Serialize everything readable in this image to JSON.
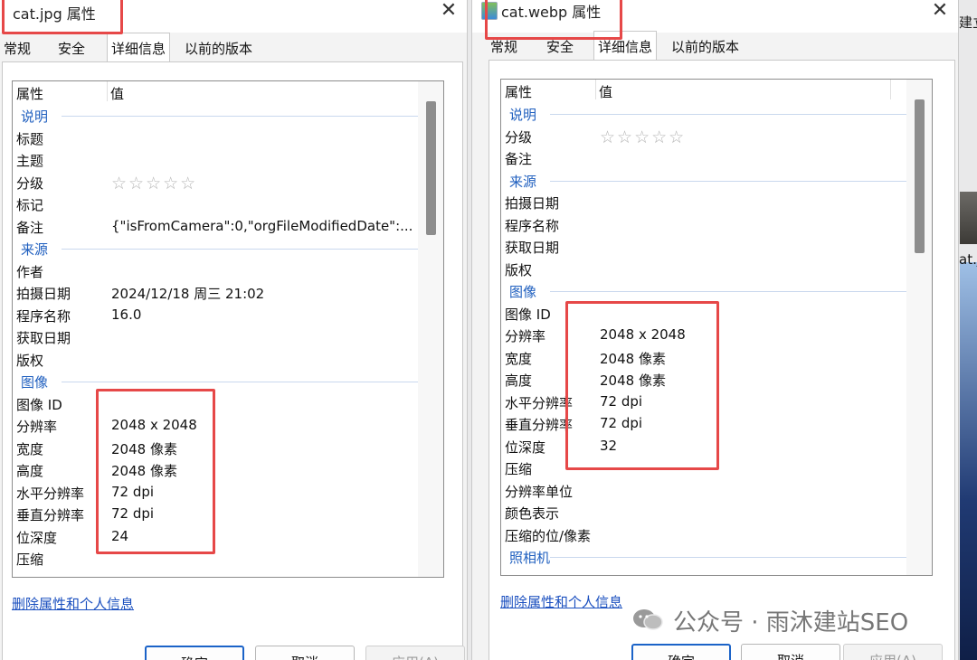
{
  "left": {
    "title": "cat.jpg 属性",
    "tabs": [
      "常规",
      "安全",
      "详细信息",
      "以前的版本"
    ],
    "header": {
      "property": "属性",
      "value": "值"
    },
    "rows": [
      {
        "k": "说明",
        "section": true
      },
      {
        "k": "标题",
        "v": ""
      },
      {
        "k": "主题",
        "v": ""
      },
      {
        "k": "分级",
        "v": "☆☆☆☆☆",
        "stars": true
      },
      {
        "k": "标记",
        "v": ""
      },
      {
        "k": "备注",
        "v": "{\"isFromCamera\":0,\"orgFileModifiedDate\":..."
      },
      {
        "k": "来源",
        "section": true
      },
      {
        "k": "作者",
        "v": ""
      },
      {
        "k": "拍摄日期",
        "v": "2024/12/18 周三 21:02"
      },
      {
        "k": "程序名称",
        "v": "16.0"
      },
      {
        "k": "获取日期",
        "v": ""
      },
      {
        "k": "版权",
        "v": ""
      },
      {
        "k": "图像",
        "section": true
      },
      {
        "k": "图像 ID",
        "v": ""
      },
      {
        "k": "分辨率",
        "v": "2048 x 2048"
      },
      {
        "k": "宽度",
        "v": "2048 像素"
      },
      {
        "k": "高度",
        "v": "2048 像素"
      },
      {
        "k": "水平分辨率",
        "v": "72 dpi"
      },
      {
        "k": "垂直分辨率",
        "v": "72 dpi"
      },
      {
        "k": "位深度",
        "v": "24"
      },
      {
        "k": "压缩",
        "v": ""
      }
    ],
    "remove_link": "删除属性和个人信息",
    "buttons": {
      "ok": "确定",
      "cancel": "取消",
      "apply": "应用(A)"
    }
  },
  "right": {
    "title": "cat.webp 属性",
    "tabs": [
      "常规",
      "安全",
      "详细信息",
      "以前的版本"
    ],
    "header": {
      "property": "属性",
      "value": "值"
    },
    "rows": [
      {
        "k": "说明",
        "section": true
      },
      {
        "k": "分级",
        "v": "☆☆☆☆☆",
        "stars": true
      },
      {
        "k": "备注",
        "v": ""
      },
      {
        "k": "来源",
        "section": true
      },
      {
        "k": "拍摄日期",
        "v": ""
      },
      {
        "k": "程序名称",
        "v": ""
      },
      {
        "k": "获取日期",
        "v": ""
      },
      {
        "k": "版权",
        "v": ""
      },
      {
        "k": "图像",
        "section": true
      },
      {
        "k": "图像 ID",
        "v": ""
      },
      {
        "k": "分辨率",
        "v": "2048 x 2048"
      },
      {
        "k": "宽度",
        "v": "2048 像素"
      },
      {
        "k": "高度",
        "v": "2048 像素"
      },
      {
        "k": "水平分辨率",
        "v": "72 dpi"
      },
      {
        "k": "垂直分辨率",
        "v": "72 dpi"
      },
      {
        "k": "位深度",
        "v": "32"
      },
      {
        "k": "压缩",
        "v": ""
      },
      {
        "k": "分辨率单位",
        "v": ""
      },
      {
        "k": "颜色表示",
        "v": ""
      },
      {
        "k": "压缩的位/像素",
        "v": ""
      },
      {
        "k": "照相机",
        "section": true
      }
    ],
    "remove_link": "删除属性和个人信息",
    "buttons": {
      "ok": "确定",
      "cancel": "取消",
      "apply": "应用(A)"
    }
  },
  "watermark": "公众号 · 雨沐建站SEO",
  "desktop": {
    "file_label": "at.jp",
    "top_label": "建立"
  },
  "colors": {
    "highlight": "#e64848",
    "section": "#1f5fbf",
    "link": "#1a4fbf",
    "primary_border": "#1b63c8"
  }
}
